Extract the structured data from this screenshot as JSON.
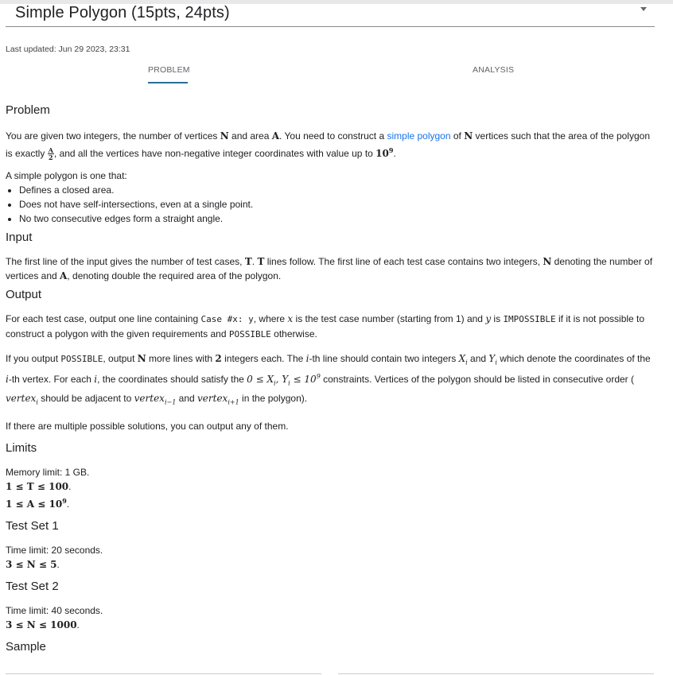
{
  "header": {
    "title": "Simple Polygon (15pts, 24pts)",
    "updated": "Last updated: Jun 29 2023, 23:31"
  },
  "tabs": [
    {
      "label": "PROBLEM",
      "active": true
    },
    {
      "label": "ANALYSIS",
      "active": false
    }
  ],
  "problem": {
    "heading": "Problem",
    "p1_a": "You are given two integers, the number of vertices ",
    "p1_N": "N",
    "p1_b": " and area ",
    "p1_A": "A",
    "p1_c": ". You need to construct a ",
    "p1_link": "simple polygon",
    "p1_d": " of ",
    "p1_N2": "N",
    "p1_e": " vertices such that the area of the polygon is exactly ",
    "p1_frac_num": "A",
    "p1_frac_den": "2",
    "p1_f": ", and all the vertices have non-negative integer coordinates with value up to ",
    "p1_pow_base": "10",
    "p1_pow_exp": "9",
    "p1_g": ".",
    "simple_intro": "A simple polygon is one that:",
    "bullets": [
      "Defines a closed area.",
      "Does not have self-intersections, even at a single point.",
      "No two consecutive edges form a straight angle."
    ]
  },
  "input": {
    "heading": "Input",
    "a": "The first line of the input gives the number of test cases, ",
    "T1": "T",
    "b": ". ",
    "T2": "T",
    "c": " lines follow. The first line of each test case contains two integers, ",
    "N": "N",
    "d": " denoting the number of vertices and ",
    "A": "A",
    "e": ", denoting double the required area of the polygon."
  },
  "output": {
    "heading": "Output",
    "p1_a": "For each test case, output one line containing ",
    "p1_code": "Case #x: y",
    "p1_b": ", where ",
    "p1_x": "x",
    "p1_c": " is the test case number (starting from 1) and ",
    "p1_y": "y",
    "p1_d": " is ",
    "p1_imp": "IMPOSSIBLE",
    "p1_e": " if it is not possible to construct a polygon with the given requirements and ",
    "p1_pos": "POSSIBLE",
    "p1_f": " otherwise.",
    "p2_a": "If you output ",
    "p2_pos": "POSSIBLE",
    "p2_b": ", output ",
    "p2_N": "N",
    "p2_c": " more lines with ",
    "p2_2": "2",
    "p2_d": " integers each. The ",
    "p2_i": "i",
    "p2_e": "-th line should contain two integers ",
    "p2_Xi": "X",
    "p2_Xi_sub": "i",
    "p2_f": " and ",
    "p2_Yi": "Y",
    "p2_Yi_sub": "i",
    "p2_g": " which denote the coordinates of the ",
    "p2_i2": "i",
    "p2_h": "-th vertex. For each ",
    "p2_i3": "i",
    "p2_j": ", the coordinates should satisfy the ",
    "p2_constraint": "0 ≤ X",
    "p2_constraint_sub1": "i",
    "p2_constraint_mid": ", Y",
    "p2_constraint_sub2": "i",
    "p2_constraint_end": " ≤ 10",
    "p2_constraint_exp": "9",
    "p2_k": " constraints. Vertices of the polygon should be listed in consecutive order ( ",
    "p2_vert1": "vertex",
    "p2_vert1_sub": "i",
    "p2_l": " should be adjacent to ",
    "p2_vert2": "vertex",
    "p2_vert2_sub": "i−1",
    "p2_m": " and ",
    "p2_vert3": "vertex",
    "p2_vert3_sub": "i+1",
    "p2_n": " in the polygon).",
    "p3": "If there are multiple possible solutions, you can output any of them."
  },
  "limits": {
    "heading": "Limits",
    "memory": "Memory limit: 1 GB.",
    "l1": "1 ≤ T ≤ 100",
    "l1_end": ".",
    "l2": "1 ≤ A ≤ 10",
    "l2_exp": "9",
    "l2_end": "."
  },
  "test_set_1": {
    "heading": "Test Set 1",
    "time": "Time limit: 20 seconds.",
    "constraint": "3 ≤ N ≤ 5",
    "end": "."
  },
  "test_set_2": {
    "heading": "Test Set 2",
    "time": "Time limit: 40 seconds.",
    "constraint": "3 ≤ N ≤ 1000",
    "end": "."
  },
  "sample": {
    "heading": "Sample"
  }
}
